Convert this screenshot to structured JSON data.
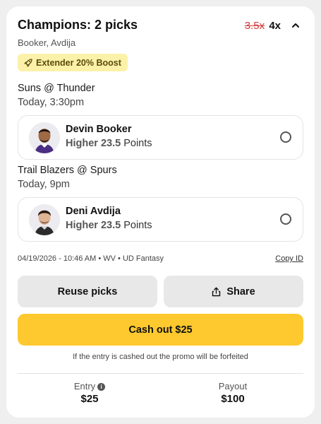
{
  "entry_card": {
    "title": "Champions: 2 picks",
    "old_multiplier": "3.5x",
    "new_multiplier": "4x",
    "subtitle": "Booker, Avdija",
    "boost_label": "Extender 20% Boost"
  },
  "picks": [
    {
      "game": "Suns @ Thunder",
      "time": "Today, 3:30pm",
      "player": "Devin Booker",
      "direction": "Higher",
      "line": "23.5",
      "stat": "Points"
    },
    {
      "game": "Trail Blazers @ Spurs",
      "time": "Today, 9pm",
      "player": "Deni Avdija",
      "direction": "Higher",
      "line": "23.5",
      "stat": "Points"
    }
  ],
  "meta": {
    "text": "04/19/2026 - 10:46 AM • WV • UD Fantasy",
    "copy_id": "Copy ID"
  },
  "actions": {
    "reuse": "Reuse picks",
    "share": "Share",
    "cashout": "Cash out $25",
    "forfeit_note": "If the entry is cashed out the promo will be forfeited"
  },
  "summary": {
    "entry_label": "Entry",
    "entry_value": "$25",
    "payout_label": "Payout",
    "payout_value": "$100"
  },
  "colors": {
    "accent": "#fdc92f",
    "boost_bg": "#fbf1a8",
    "strike": "#d63a3a"
  },
  "icons": [
    "chevron-up-icon",
    "rocket-icon",
    "share-icon",
    "info-icon"
  ]
}
